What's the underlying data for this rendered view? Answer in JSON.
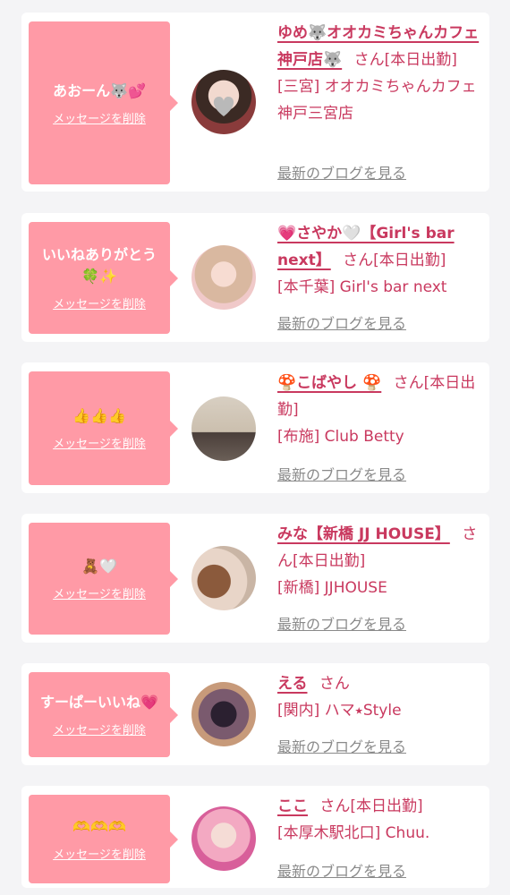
{
  "cards": [
    {
      "message": "あおーん🐺💕",
      "delete_label": "メッセージを削除",
      "name": "ゆめ🐺オオカミちゃんカフェ神戸店🐺",
      "honorific": "さん",
      "status": "[本日出勤]",
      "shop": "[三宮] オオカミちゃんカフェ神戸三宮店",
      "blog_label": "最新のブログを見る"
    },
    {
      "message": "いいねありがとう🍀✨",
      "delete_label": "メッセージを削除",
      "name": "💗さやか🤍【Girl's bar next】",
      "honorific": "さん",
      "status": "[本日出勤]",
      "shop": "[本千葉] Girl's bar next",
      "blog_label": "最新のブログを見る"
    },
    {
      "message": "👍👍👍",
      "delete_label": "メッセージを削除",
      "name": "🍄こばやし 🍄",
      "honorific": "さん",
      "status": "[本日出勤]",
      "shop": "[布施] Club Betty",
      "blog_label": "最新のブログを見る"
    },
    {
      "message": "🧸🤍",
      "delete_label": "メッセージを削除",
      "name": "みな【新橋 JJ HOUSE】",
      "honorific": "さん",
      "status": "[本日出勤]",
      "shop": "[新橋] JJHOUSE",
      "blog_label": "最新のブログを見る"
    },
    {
      "message": "すーぱーいいね💗",
      "delete_label": "メッセージを削除",
      "name": "える",
      "honorific": "さん",
      "status": "",
      "shop": "[関内] ハマ⭑Style",
      "blog_label": "最新のブログを見る"
    },
    {
      "message": "🫶🫶🫶",
      "delete_label": "メッセージを削除",
      "name": "ここ",
      "honorific": "さん",
      "status": "[本日出勤]",
      "shop": "[本厚木駅北口] Chuu.",
      "blog_label": "最新のブログを見る"
    }
  ],
  "colors": {
    "accent": "#c9395f",
    "bubble": "#ff9aa6",
    "background": "#f4f4f6",
    "link_gray": "#8a8a8a"
  }
}
